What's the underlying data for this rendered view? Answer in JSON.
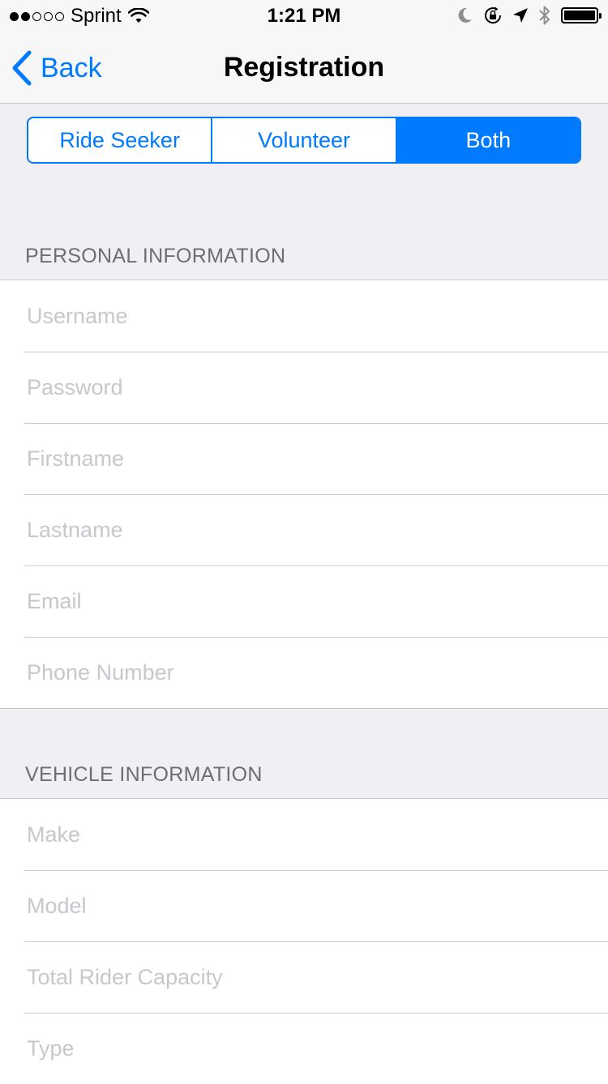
{
  "status_bar": {
    "carrier": "Sprint",
    "time": "1:21 PM",
    "signal_strength": 2,
    "signal_max": 5
  },
  "nav": {
    "back_label": "Back",
    "title": "Registration"
  },
  "segments": {
    "items": [
      {
        "label": "Ride Seeker"
      },
      {
        "label": "Volunteer"
      },
      {
        "label": "Both"
      }
    ],
    "selected": "Both"
  },
  "personal": {
    "header": "PERSONAL INFORMATION",
    "fields": [
      {
        "placeholder": "Username",
        "value": ""
      },
      {
        "placeholder": "Password",
        "value": ""
      },
      {
        "placeholder": "Firstname",
        "value": ""
      },
      {
        "placeholder": "Lastname",
        "value": ""
      },
      {
        "placeholder": "Email",
        "value": ""
      },
      {
        "placeholder": "Phone Number",
        "value": ""
      }
    ]
  },
  "vehicle": {
    "header": "VEHICLE INFORMATION",
    "fields": [
      {
        "placeholder": "Make",
        "value": ""
      },
      {
        "placeholder": "Model",
        "value": ""
      },
      {
        "placeholder": "Total Rider Capacity",
        "value": ""
      },
      {
        "placeholder": "Type",
        "value": ""
      }
    ]
  },
  "colors": {
    "accent": "#007aff",
    "background": "#efeff4",
    "placeholder": "#c7c7cd",
    "section_header": "#6d6d72"
  },
  "icons": [
    "signal-dots-icon",
    "wifi-icon",
    "moon-icon",
    "orientation-lock-icon",
    "location-arrow-icon",
    "bluetooth-icon",
    "battery-icon",
    "chevron-left-icon"
  ]
}
